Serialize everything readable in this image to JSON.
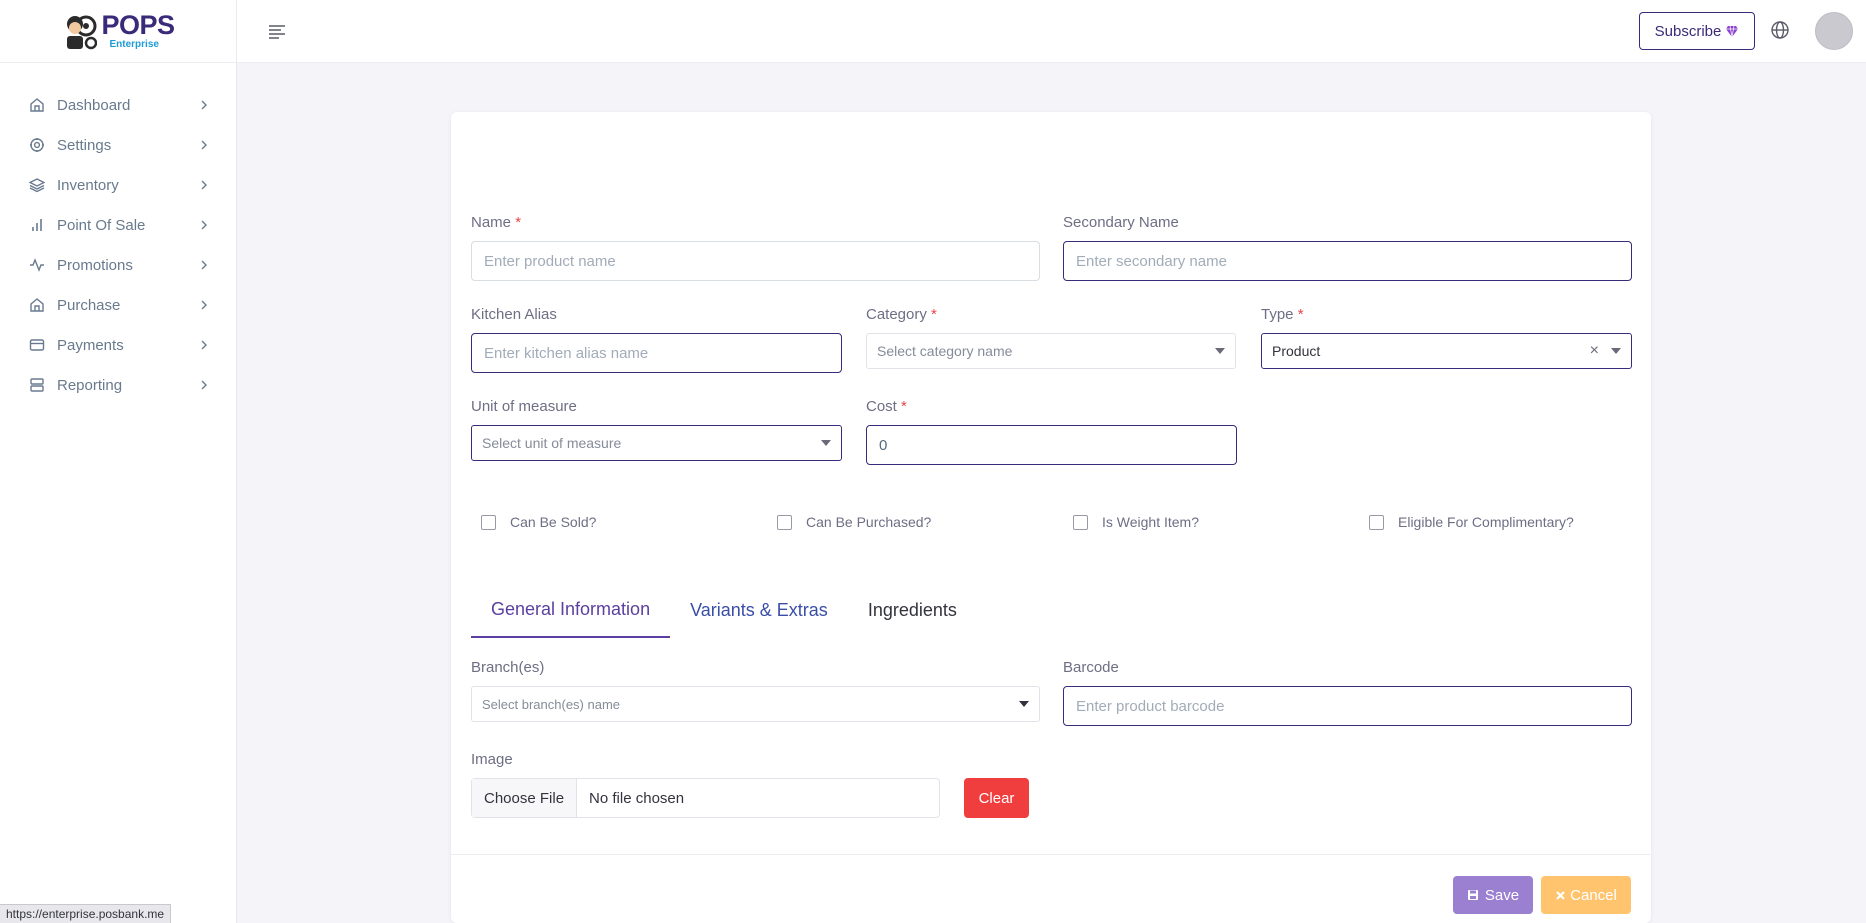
{
  "brand": {
    "name": "POPS",
    "subtitle": "Enterprise"
  },
  "sidebar": {
    "items": [
      {
        "label": "Dashboard",
        "icon": "home-icon"
      },
      {
        "label": "Settings",
        "icon": "gear-icon"
      },
      {
        "label": "Inventory",
        "icon": "layers-icon"
      },
      {
        "label": "Point Of Sale",
        "icon": "bar-chart-icon"
      },
      {
        "label": "Promotions",
        "icon": "activity-icon"
      },
      {
        "label": "Purchase",
        "icon": "home-icon"
      },
      {
        "label": "Payments",
        "icon": "credit-card-icon"
      },
      {
        "label": "Reporting",
        "icon": "server-icon"
      }
    ]
  },
  "topbar": {
    "subscribe_label": "Subscribe"
  },
  "form": {
    "name": {
      "label": "Name",
      "required": "*",
      "placeholder": "Enter product name"
    },
    "secondary_name": {
      "label": "Secondary Name",
      "placeholder": "Enter secondary name"
    },
    "kitchen_alias": {
      "label": "Kitchen Alias",
      "placeholder": "Enter kitchen alias name"
    },
    "category": {
      "label": "Category",
      "required": "*",
      "placeholder": "Select category name"
    },
    "type": {
      "label": "Type",
      "required": "*",
      "value": "Product"
    },
    "unit": {
      "label": "Unit of measure",
      "placeholder": "Select unit of measure"
    },
    "cost": {
      "label": "Cost",
      "required": "*",
      "value": "0"
    },
    "checks": {
      "can_be_sold": "Can Be Sold?",
      "can_be_purchased": "Can Be Purchased?",
      "is_weight_item": "Is Weight Item?",
      "eligible_complimentary": "Eligible For Complimentary?"
    },
    "tabs": {
      "general": "General Information",
      "variants": "Variants & Extras",
      "ingredients": "Ingredients"
    },
    "branches": {
      "label": "Branch(es)",
      "placeholder": "Select branch(es) name"
    },
    "barcode": {
      "label": "Barcode",
      "placeholder": "Enter product barcode"
    },
    "image": {
      "label": "Image",
      "choose_label": "Choose File",
      "status": "No file chosen",
      "clear_label": "Clear"
    },
    "actions": {
      "save": "Save",
      "cancel": "Cancel"
    }
  },
  "status_bar": {
    "url": "https://enterprise.posbank.me"
  },
  "colors": {
    "brand": "#3b2a7a",
    "save": "#9b7fd0",
    "cancel": "#ffc46d",
    "clear": "#f03e3e",
    "required": "#e5484d"
  }
}
